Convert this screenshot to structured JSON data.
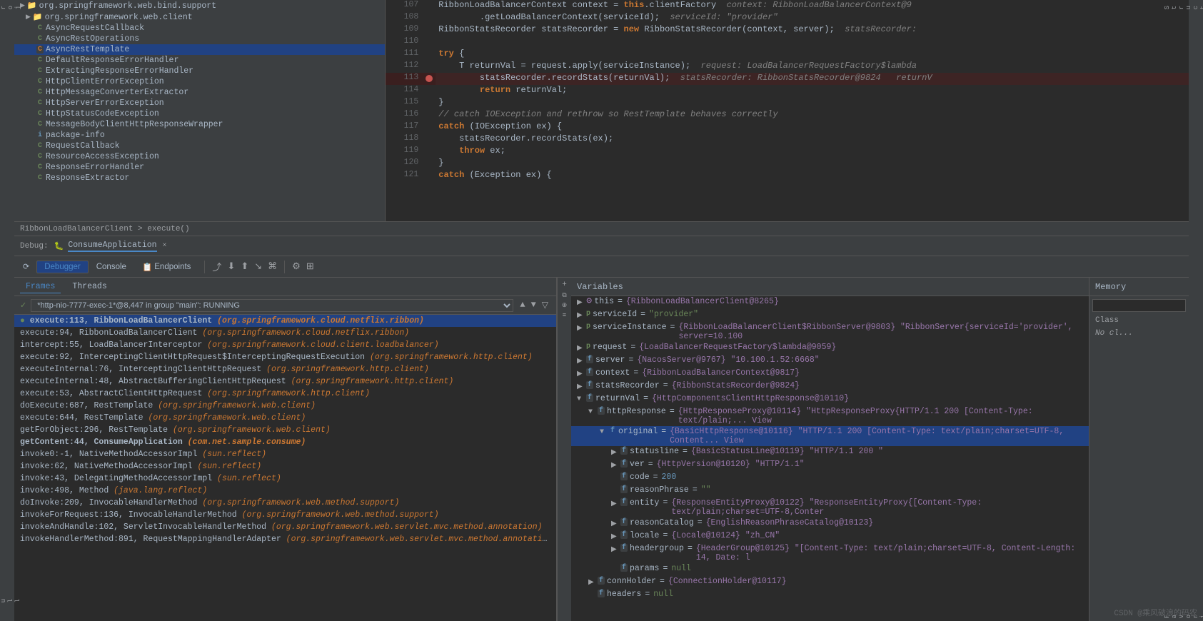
{
  "left_sidebar": {
    "icons": [
      "P",
      "⟳",
      "↓",
      "≡"
    ]
  },
  "right_sidebar": {
    "icons": [
      "⊞",
      "⊡",
      "❖",
      "◧",
      "☆"
    ]
  },
  "file_tree": {
    "items": [
      {
        "indent": 0,
        "type": "folder",
        "label": "org.springframework.web.bind.support",
        "expanded": true
      },
      {
        "indent": 1,
        "type": "folder",
        "label": "org.springframework.web.client",
        "expanded": true
      },
      {
        "indent": 2,
        "type": "class",
        "label": "AsyncRequestCallback",
        "color": "green"
      },
      {
        "indent": 2,
        "type": "class",
        "label": "AsyncRestOperations",
        "color": "green"
      },
      {
        "indent": 2,
        "type": "class",
        "label": "AsyncRestTemplate",
        "color": "orange",
        "selected": true
      },
      {
        "indent": 2,
        "type": "class",
        "label": "DefaultResponseErrorHandler",
        "color": "green"
      },
      {
        "indent": 2,
        "type": "class",
        "label": "ExtractingResponseErrorHandler",
        "color": "green"
      },
      {
        "indent": 2,
        "type": "class",
        "label": "HttpClientErrorException",
        "color": "green"
      },
      {
        "indent": 2,
        "type": "class",
        "label": "HttpMessageConverterExtractor",
        "color": "green"
      },
      {
        "indent": 2,
        "type": "class",
        "label": "HttpServerErrorException",
        "color": "green"
      },
      {
        "indent": 2,
        "type": "class",
        "label": "HttpStatusCodeException",
        "color": "green"
      },
      {
        "indent": 2,
        "type": "class",
        "label": "MessageBodyClientHttpResponseWrapper",
        "color": "green"
      },
      {
        "indent": 2,
        "type": "package",
        "label": "package-info"
      },
      {
        "indent": 2,
        "type": "class",
        "label": "RequestCallback",
        "color": "green"
      },
      {
        "indent": 2,
        "type": "class",
        "label": "ResourceAccessException",
        "color": "green"
      },
      {
        "indent": 2,
        "type": "class",
        "label": "ResponseErrorHandler",
        "color": "green"
      },
      {
        "indent": 2,
        "type": "class",
        "label": "ResponseExtractor",
        "color": "green"
      }
    ]
  },
  "code": {
    "lines": [
      {
        "num": 107,
        "content": "RibbonLoadBalancerContext context = this.clientFactory",
        "comment": "  context: RibbonLoadBalancerContext@9",
        "highlight": false,
        "breakpoint": false
      },
      {
        "num": 108,
        "content": "        .getLoadBalancerContext(serviceId);",
        "comment": "  serviceId: \"provider\"",
        "highlight": false,
        "breakpoint": false
      },
      {
        "num": 109,
        "content": "RibbonStatsRecorder statsRecorder = new RibbonStatsRecorder(context, server);",
        "comment": "  statsRecorder:",
        "highlight": false,
        "breakpoint": false
      },
      {
        "num": 110,
        "content": "",
        "highlight": false,
        "breakpoint": false
      },
      {
        "num": 111,
        "content": "try {",
        "highlight": false,
        "breakpoint": false
      },
      {
        "num": 112,
        "content": "    T returnVal = request.apply(serviceInstance);",
        "comment": "  request: LoadBalancerRequestFactory$lambda",
        "highlight": false,
        "breakpoint": false
      },
      {
        "num": 113,
        "content": "        statsRecorder.recordStats(returnVal);",
        "comment": "  statsRecorder: RibbonStatsRecorder@9824   returnV",
        "highlight": true,
        "breakpoint": true
      },
      {
        "num": 114,
        "content": "        return returnVal;",
        "highlight": false,
        "breakpoint": false
      },
      {
        "num": 115,
        "content": "}",
        "highlight": false,
        "breakpoint": false
      },
      {
        "num": 116,
        "content": "// catch IOException and rethrow so RestTemplate behaves correctly",
        "highlight": false,
        "breakpoint": false,
        "is_comment": true
      },
      {
        "num": 117,
        "content": "catch (IOException ex) {",
        "highlight": false,
        "breakpoint": false
      },
      {
        "num": 118,
        "content": "    statsRecorder.recordStats(ex);",
        "highlight": false,
        "breakpoint": false
      },
      {
        "num": 119,
        "content": "    throw ex;",
        "highlight": false,
        "breakpoint": false
      },
      {
        "num": 120,
        "content": "}",
        "highlight": false,
        "breakpoint": false
      },
      {
        "num": 121,
        "content": "catch (Exception ex) {",
        "highlight": false,
        "breakpoint": false
      }
    ]
  },
  "breadcrumb": {
    "text": "RibbonLoadBalancerClient  >  execute()"
  },
  "debug": {
    "header_label": "Debug:",
    "app_name": "ConsumeApplication",
    "close_label": "×",
    "tabs": {
      "debugger": "Debugger",
      "console": "Console",
      "endpoints": "Endpoints"
    },
    "sub_tabs": [
      "Frames",
      "Threads"
    ],
    "active_sub_tab": "Frames"
  },
  "thread": {
    "label": "✓ *http-nio-7777-exec-1*@8,447 in group \"main\": RUNNING",
    "dropdown_text": "*http-nio-7777-exec-1*@8,447 in group \"main\": RUNNING"
  },
  "frames": [
    {
      "num": "",
      "method": "execute:113, RibbonLoadBalancerClient",
      "pkg": "(org.springframework.cloud.netflix.ribbon)",
      "selected": true,
      "bold": true
    },
    {
      "num": "",
      "method": "execute:94, RibbonLoadBalancerClient",
      "pkg": "(org.springframework.cloud.netflix.ribbon)",
      "selected": false
    },
    {
      "num": "",
      "method": "intercept:55, LoadBalancerInterceptor",
      "pkg": "(org.springframework.cloud.client.loadbalancer)",
      "selected": false
    },
    {
      "num": "",
      "method": "execute:92, InterceptingClientHttpRequest$InterceptingRequestExecution",
      "pkg": "(org.springframework.http.client)",
      "selected": false
    },
    {
      "num": "",
      "method": "executeInternal:76, InterceptingClientHttpRequest",
      "pkg": "(org.springframework.http.client)",
      "selected": false
    },
    {
      "num": "",
      "method": "executeInternal:48, AbstractBufferingClientHttpRequest",
      "pkg": "(org.springframework.http.client)",
      "selected": false
    },
    {
      "num": "",
      "method": "execute:53, AbstractClientHttpRequest",
      "pkg": "(org.springframework.http.client)",
      "selected": false
    },
    {
      "num": "",
      "method": "doExecute:687, RestTemplate",
      "pkg": "(org.springframework.web.client)",
      "selected": false
    },
    {
      "num": "",
      "method": "execute:644, RestTemplate",
      "pkg": "(org.springframework.web.client)",
      "selected": false
    },
    {
      "num": "",
      "method": "getForObject:296, RestTemplate",
      "pkg": "(org.springframework.web.client)",
      "selected": false
    },
    {
      "num": "",
      "method": "getContent:44, ConsumeApplication",
      "pkg": "(com.net.sample.consume)",
      "selected": false,
      "bold": true
    },
    {
      "num": "",
      "method": "invoke0:-1, NativeMethodAccessorImpl",
      "pkg": "(sun.reflect)",
      "selected": false
    },
    {
      "num": "",
      "method": "invoke:62, NativeMethodAccessorImpl",
      "pkg": "(sun.reflect)",
      "selected": false
    },
    {
      "num": "",
      "method": "invoke:43, DelegatingMethodAccessorImpl",
      "pkg": "(sun.reflect)",
      "selected": false
    },
    {
      "num": "",
      "method": "invoke:498, Method",
      "pkg": "(java.lang.reflect)",
      "selected": false
    },
    {
      "num": "",
      "method": "doInvoke:209, InvocableHandlerMethod",
      "pkg": "(org.springframework.web.method.support)",
      "selected": false
    },
    {
      "num": "",
      "method": "invokeForRequest:136, InvocableHandlerMethod",
      "pkg": "(org.springframework.web.method.support)",
      "selected": false
    },
    {
      "num": "",
      "method": "invokeAndHandle:102, ServletInvocableHandlerMethod",
      "pkg": "(org.springframework.web.servlet.mvc.method.annotation)",
      "selected": false
    },
    {
      "num": "",
      "method": "invokeHandlerMethod:891, RequestMappingHandlerAdapter",
      "pkg": "(org.springframework.web.servlet.mvc.method.annotation)",
      "selected": false
    }
  ],
  "variables": {
    "header": "Variables",
    "items": [
      {
        "indent": 0,
        "expand": "▶",
        "icon": "this",
        "name": "this",
        "value": "= {RibbonLoadBalancerClient@8265}",
        "type": ""
      },
      {
        "indent": 0,
        "expand": "▶",
        "icon": "p",
        "name": "serviceId",
        "value": "= \"provider\"",
        "type": ""
      },
      {
        "indent": 0,
        "expand": "▶",
        "icon": "p",
        "name": "serviceInstance",
        "value": "= {RibbonLoadBalancerClient$RibbonServer@9803} \"RibbonServer{serviceId='provider', server=10.100",
        "type": ""
      },
      {
        "indent": 0,
        "expand": "▶",
        "icon": "p",
        "name": "request",
        "value": "= {LoadBalancerRequestFactory$lambda@9059}",
        "type": ""
      },
      {
        "indent": 0,
        "expand": "▶",
        "icon": "=",
        "name": "server",
        "value": "= {NacosServer@9767} \"10.100.1.52:6668\"",
        "type": ""
      },
      {
        "indent": 0,
        "expand": "▶",
        "icon": "=",
        "name": "context",
        "value": "= {RibbonLoadBalancerContext@9817}",
        "type": ""
      },
      {
        "indent": 0,
        "expand": "▶",
        "icon": "=",
        "name": "statsRecorder",
        "value": "= {RibbonStatsRecorder@9824}",
        "type": ""
      },
      {
        "indent": 0,
        "expand": "▼",
        "icon": "=",
        "name": "returnVal",
        "value": "= {HttpComponentsClientHttpResponse@10110}",
        "type": ""
      },
      {
        "indent": 1,
        "expand": "▼",
        "icon": "f",
        "name": "httpResponse",
        "value": "= {HttpResponseProxy@10114} \"HttpResponseProxy{HTTP/1.1 200  [Content-Type: text/plain;... View",
        "type": "",
        "selected": false
      },
      {
        "indent": 2,
        "expand": "▼",
        "icon": "f",
        "name": "original",
        "value": "= {BasicHttpResponse@10116} \"HTTP/1.1 200  [Content-Type: text/plain;charset=UTF-8, Content... View",
        "type": "",
        "selected": true
      },
      {
        "indent": 3,
        "expand": "▶",
        "icon": "f",
        "name": "statusline",
        "value": "= {BasicStatusLine@10119} \"HTTP/1.1 200 \"",
        "type": ""
      },
      {
        "indent": 3,
        "expand": "▶",
        "icon": "f",
        "name": "ver",
        "value": "= {HttpVersion@10120} \"HTTP/1.1\"",
        "type": ""
      },
      {
        "indent": 3,
        "expand": "",
        "icon": "f",
        "name": "code",
        "value": "= 200",
        "type": ""
      },
      {
        "indent": 3,
        "expand": "",
        "icon": "f",
        "name": "reasonPhrase",
        "value": "= \"\"",
        "type": ""
      },
      {
        "indent": 3,
        "expand": "▶",
        "icon": "f",
        "name": "entity",
        "value": "= {ResponseEntityProxy@10122} \"ResponseEntityProxy{[Content-Type: text/plain;charset=UTF-8,Conter",
        "type": ""
      },
      {
        "indent": 3,
        "expand": "▶",
        "icon": "f",
        "name": "reasonCatalog",
        "value": "= {EnglishReasonPhraseCatalog@10123}",
        "type": ""
      },
      {
        "indent": 3,
        "expand": "▶",
        "icon": "f",
        "name": "locale",
        "value": "= {Locale@10124} \"zh_CN\"",
        "type": ""
      },
      {
        "indent": 3,
        "expand": "▶",
        "icon": "f",
        "name": "headergroup",
        "value": "= {HeaderGroup@10125} \"[Content-Type: text/plain;charset=UTF-8, Content-Length: 14, Date: l",
        "type": ""
      },
      {
        "indent": 3,
        "expand": "",
        "icon": "f",
        "name": "params",
        "value": "= null",
        "type": ""
      },
      {
        "indent": 1,
        "expand": "▶",
        "icon": "f",
        "name": "connHolder",
        "value": "= {ConnectionHolder@10117}",
        "type": ""
      },
      {
        "indent": 1,
        "expand": "",
        "icon": "f",
        "name": "headers",
        "value": "= null",
        "type": ""
      }
    ]
  },
  "memory": {
    "header": "Memory",
    "search_placeholder": "",
    "class_label": "Class",
    "note": "No cl..."
  },
  "watermark": "CSDN @乘风破浪的码农"
}
